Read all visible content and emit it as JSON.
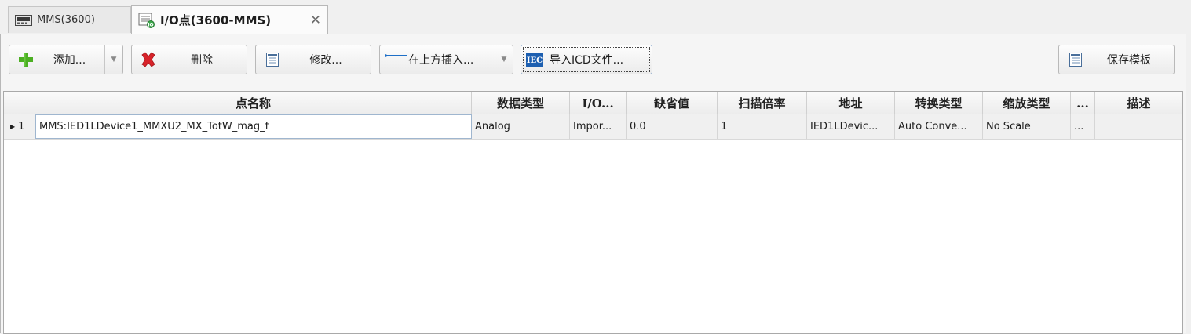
{
  "tabs": [
    {
      "label": "MMS(3600)",
      "active": false,
      "icon": "device-icon"
    },
    {
      "label": "I/O点(3600-MMS)",
      "active": true,
      "icon": "io-points-icon",
      "close": "✕"
    }
  ],
  "toolbar": {
    "add_label": "添加...",
    "delete_label": "删除",
    "modify_label": "修改...",
    "insert_above_label": "在上方插入...",
    "import_icd_label": "导入ICD文件...",
    "save_template_label": "保存模板"
  },
  "grid": {
    "columns": [
      "点名称",
      "数据类型",
      "I/O...",
      "缺省值",
      "扫描倍率",
      "地址",
      "转换类型",
      "缩放类型",
      "...",
      "描述"
    ],
    "rows": [
      {
        "indicator": "1",
        "cells": [
          "MMS:IED1LDevice1_MMXU2_MX_TotW_mag_f",
          "Analog",
          "Impor...",
          "0.0",
          "1",
          "IED1LDevic...",
          "Auto Conve...",
          "No Scale",
          "...",
          ""
        ]
      }
    ]
  },
  "colors": {
    "add_green": "#4caf22",
    "delete_red": "#d8232a",
    "iec_blue": "#1d5fb0"
  }
}
